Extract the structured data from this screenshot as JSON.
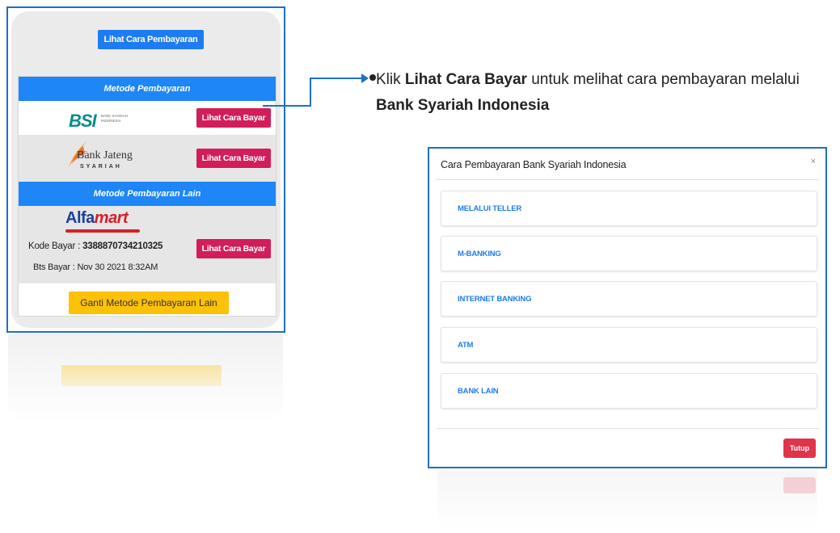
{
  "left_panel": {
    "top_button": "Lihat Cara Pembayaran",
    "section_methods": "Metode Pembayaran",
    "section_other": "Metode Pembayaran Lain",
    "pay_button": "Lihat Cara Bayar",
    "bsi": {
      "logo": "BSI",
      "sub": "BANK SYARIAH INDONESIA"
    },
    "jateng": {
      "logo": "Bank Jateng",
      "sub": "SYARIAH"
    },
    "alfamart": {
      "logo_a": "Alfa",
      "logo_b": "mart"
    },
    "kode_label": "Kode Bayar : ",
    "kode_value": "3388870734210325",
    "bts_label": "Bts Bayar : Nov 30 2021 8:32AM",
    "ganti_button": "Ganti Metode Pembayaran Lain"
  },
  "instruction": {
    "prefix": "Klik ",
    "bold1": "Lihat Cara Bayar",
    "middle": " untuk melihat cara pembayaran melalui ",
    "bold2": "Bank Syariah Indonesia"
  },
  "modal": {
    "title": "Cara Pembayaran Bank Syariah Indonesia",
    "close": "×",
    "options": [
      "MELALUI TELLER",
      "M-BANKING",
      "INTERNET BANKING",
      "ATM",
      "BANK LAIN"
    ],
    "close_button": "Tutup"
  },
  "colors": {
    "frame_blue": "#1f6fc4",
    "button_blue": "#1e7cf2",
    "pink_button": "#d21d5a",
    "yellow_button": "#fdc107",
    "tutup_red": "#e0344a"
  }
}
